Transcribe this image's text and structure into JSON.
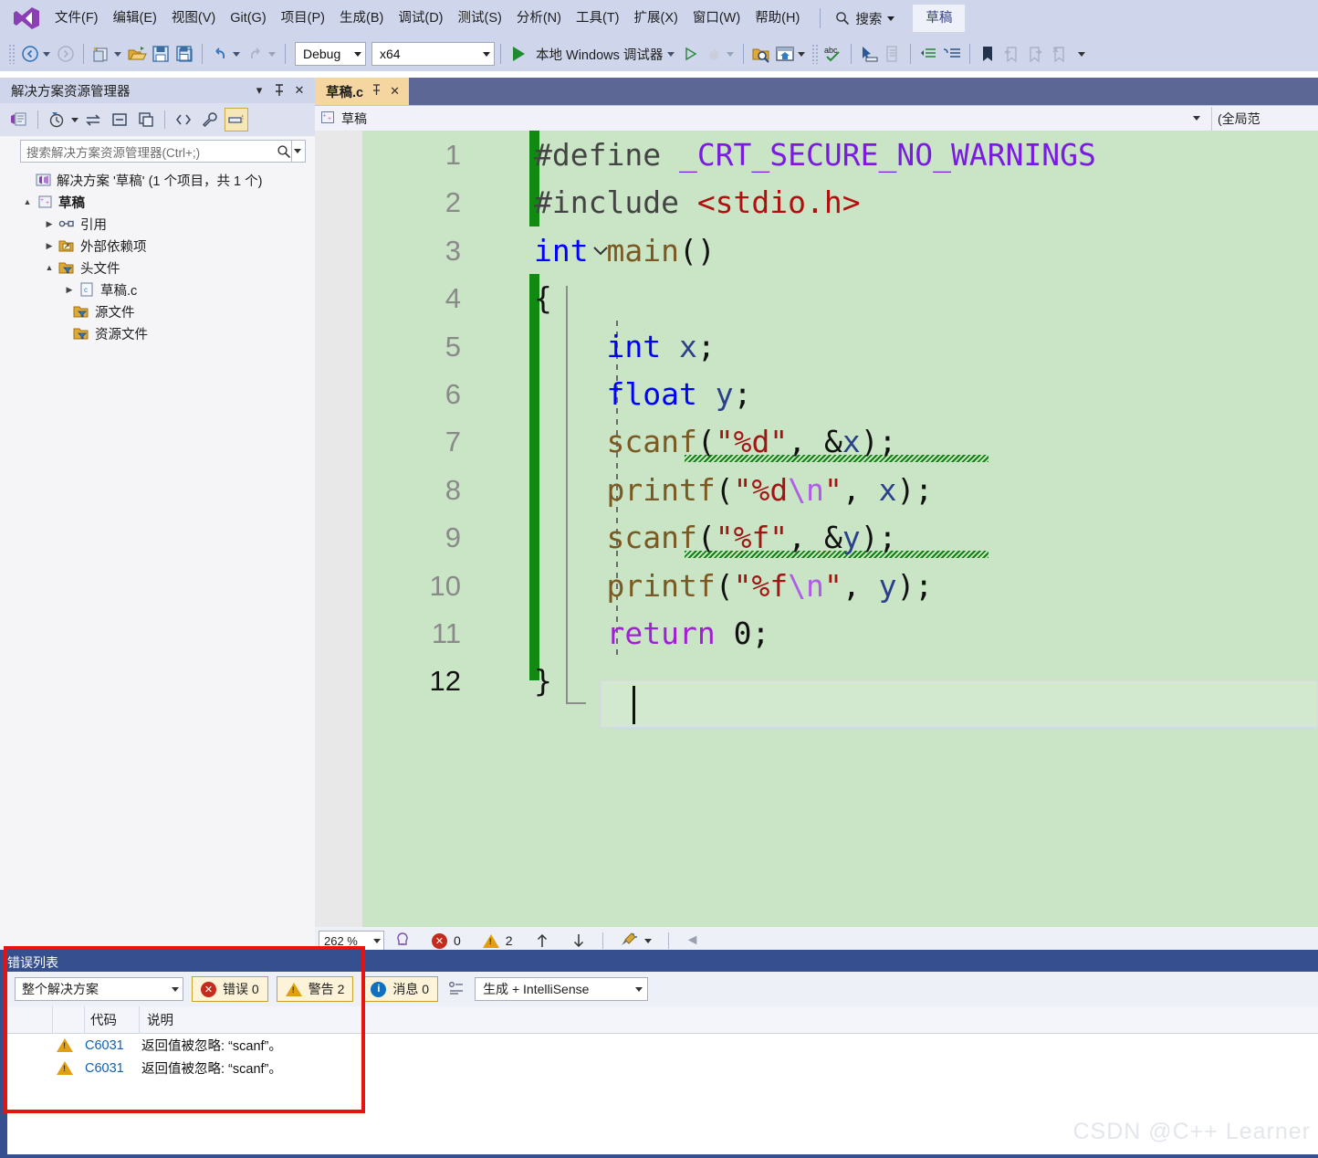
{
  "menu": {
    "items": [
      "文件(F)",
      "编辑(E)",
      "视图(V)",
      "Git(G)",
      "项目(P)",
      "生成(B)",
      "调试(D)",
      "测试(S)",
      "分析(N)",
      "工具(T)",
      "扩展(X)",
      "窗口(W)",
      "帮助(H)"
    ],
    "search_label": "搜索",
    "project_chip": "草稿"
  },
  "toolbar": {
    "config": "Debug",
    "platform": "x64",
    "debug_label": "本地 Windows 调试器"
  },
  "solution_explorer": {
    "title": "解决方案资源管理器",
    "search_placeholder": "搜索解决方案资源管理器(Ctrl+;)",
    "tree": [
      {
        "label": "解决方案 '草稿' (1 个项目，共 1 个)",
        "indent": 0,
        "expander": "",
        "icon": "solution-icon"
      },
      {
        "label": "草稿",
        "indent": 1,
        "expander": "▲",
        "icon": "cpp-project-icon"
      },
      {
        "label": "引用",
        "indent": 2,
        "expander": "▶",
        "icon": "references-icon"
      },
      {
        "label": "外部依赖项",
        "indent": 2,
        "expander": "▶",
        "icon": "external-deps-icon"
      },
      {
        "label": "头文件",
        "indent": 2,
        "expander": "▲",
        "icon": "filter-folder-icon"
      },
      {
        "label": "草稿.c",
        "indent": 3,
        "expander": "▶",
        "icon": "c-file-icon"
      },
      {
        "label": "源文件",
        "indent": 2,
        "expander": "",
        "icon": "filter-folder-icon"
      },
      {
        "label": "资源文件",
        "indent": 2,
        "expander": "",
        "icon": "filter-folder-icon"
      }
    ]
  },
  "editor": {
    "tab_label": "草稿.c",
    "nav_scope_left": "草稿",
    "nav_scope_right": "(全局范",
    "zoom": "262 %",
    "error_count": "0",
    "warning_count": "2",
    "lines": [
      {
        "n": "1",
        "tokens": [
          {
            "t": "#define ",
            "c": "k-plain"
          },
          {
            "t": "_CRT_SECURE_NO_WARNINGS",
            "c": "k-macro"
          }
        ]
      },
      {
        "n": "2",
        "tokens": [
          {
            "t": "#include ",
            "c": "k-plain"
          },
          {
            "t": "<stdio.h>",
            "c": "k-inc"
          }
        ]
      },
      {
        "n": "3",
        "tokens": [
          {
            "t": "int",
            "c": "k-blue"
          },
          {
            "t": " ",
            "c": "k-plain"
          },
          {
            "t": "main",
            "c": "k-fn"
          },
          {
            "t": "()",
            "c": "k-brace"
          }
        ]
      },
      {
        "n": "4",
        "tokens": [
          {
            "t": "{",
            "c": "k-brace"
          }
        ]
      },
      {
        "n": "5",
        "tokens": [
          {
            "t": "    ",
            "c": "k-plain"
          },
          {
            "t": "int",
            "c": "k-blue"
          },
          {
            "t": " ",
            "c": "k-plain"
          },
          {
            "t": "x",
            "c": "k-var"
          },
          {
            "t": ";",
            "c": "k-brace"
          }
        ]
      },
      {
        "n": "6",
        "tokens": [
          {
            "t": "    ",
            "c": "k-plain"
          },
          {
            "t": "float",
            "c": "k-blue"
          },
          {
            "t": " ",
            "c": "k-plain"
          },
          {
            "t": "y",
            "c": "k-var"
          },
          {
            "t": ";",
            "c": "k-brace"
          }
        ]
      },
      {
        "n": "7",
        "tokens": [
          {
            "t": "    ",
            "c": "k-plain"
          },
          {
            "t": "scanf",
            "c": "k-fn"
          },
          {
            "t": "(",
            "c": "k-brace"
          },
          {
            "t": "\"%d\"",
            "c": "k-str"
          },
          {
            "t": ", ",
            "c": "k-brace"
          },
          {
            "t": "&",
            "c": "k-brace"
          },
          {
            "t": "x",
            "c": "k-var"
          },
          {
            "t": ");",
            "c": "k-brace"
          }
        ]
      },
      {
        "n": "8",
        "tokens": [
          {
            "t": "    ",
            "c": "k-plain"
          },
          {
            "t": "printf",
            "c": "k-fn"
          },
          {
            "t": "(",
            "c": "k-brace"
          },
          {
            "t": "\"%d",
            "c": "k-str"
          },
          {
            "t": "\\n",
            "c": "k-esc"
          },
          {
            "t": "\"",
            "c": "k-str"
          },
          {
            "t": ", ",
            "c": "k-brace"
          },
          {
            "t": "x",
            "c": "k-var"
          },
          {
            "t": ");",
            "c": "k-brace"
          }
        ]
      },
      {
        "n": "9",
        "tokens": [
          {
            "t": "    ",
            "c": "k-plain"
          },
          {
            "t": "scanf",
            "c": "k-fn"
          },
          {
            "t": "(",
            "c": "k-brace"
          },
          {
            "t": "\"%f\"",
            "c": "k-str"
          },
          {
            "t": ", ",
            "c": "k-brace"
          },
          {
            "t": "&",
            "c": "k-brace"
          },
          {
            "t": "y",
            "c": "k-var"
          },
          {
            "t": ");",
            "c": "k-brace"
          }
        ]
      },
      {
        "n": "10",
        "tokens": [
          {
            "t": "    ",
            "c": "k-plain"
          },
          {
            "t": "printf",
            "c": "k-fn"
          },
          {
            "t": "(",
            "c": "k-brace"
          },
          {
            "t": "\"%f",
            "c": "k-str"
          },
          {
            "t": "\\n",
            "c": "k-esc"
          },
          {
            "t": "\"",
            "c": "k-str"
          },
          {
            "t": ", ",
            "c": "k-brace"
          },
          {
            "t": "y",
            "c": "k-var"
          },
          {
            "t": ");",
            "c": "k-brace"
          }
        ]
      },
      {
        "n": "11",
        "tokens": [
          {
            "t": "    ",
            "c": "k-plain"
          },
          {
            "t": "return",
            "c": "k-purple"
          },
          {
            "t": " ",
            "c": "k-plain"
          },
          {
            "t": "0",
            "c": "k-brace"
          },
          {
            "t": ";",
            "c": "k-brace"
          }
        ]
      },
      {
        "n": "12",
        "tokens": [
          {
            "t": "}",
            "c": "k-brace"
          }
        ],
        "current": true
      }
    ]
  },
  "error_list": {
    "title": "错误列表",
    "scope": "整个解决方案",
    "errors_label": "错误 0",
    "warnings_label": "警告 2",
    "messages_label": "消息 0",
    "build_filter": "生成 + IntelliSense",
    "columns": [
      "",
      "",
      "代码",
      "说明"
    ],
    "rows": [
      {
        "severity": "warning-icon",
        "code": "C6031",
        "description": "返回值被忽略: “scanf”。"
      },
      {
        "severity": "warning-icon",
        "code": "C6031",
        "description": "返回值被忽略: “scanf”。"
      }
    ]
  },
  "watermark": "CSDN @C++ Learner",
  "colors": {
    "chrome": "#cfd6ec",
    "editor_bg": "#c9e5c5",
    "panel_blue": "#36508f",
    "tab_active": "#f6d6a0",
    "change_bar": "#108a10",
    "highlight_box": "#e8130f"
  }
}
